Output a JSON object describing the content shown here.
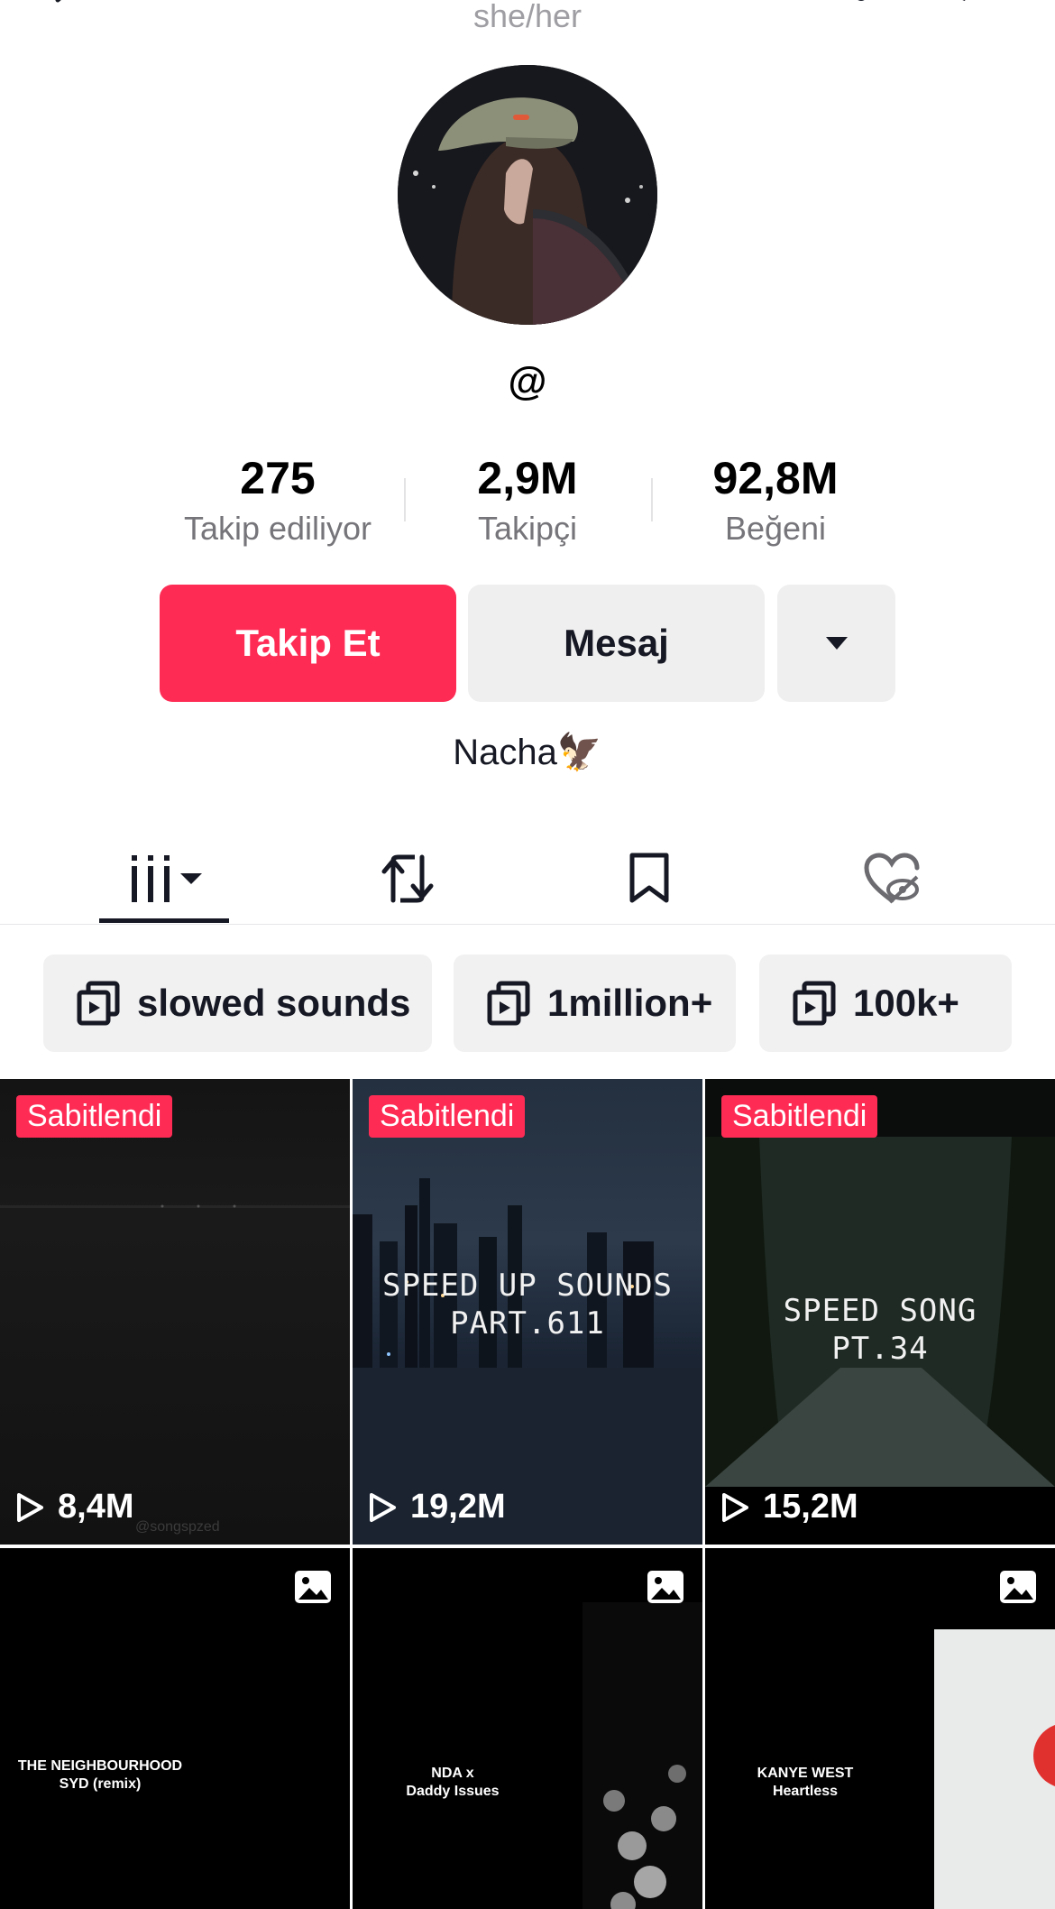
{
  "profile": {
    "pronouns": "she/her",
    "handle": "@",
    "bio": "Nacha🦅"
  },
  "stats": [
    {
      "value": "275",
      "label": "Takip ediliyor"
    },
    {
      "value": "2,9M",
      "label": "Takipçi"
    },
    {
      "value": "92,8M",
      "label": "Beğeni"
    }
  ],
  "buttons": {
    "follow": "Takip Et",
    "message": "Mesaj"
  },
  "playlists": [
    {
      "label": "slowed sounds"
    },
    {
      "label": "1million+"
    },
    {
      "label": "100k+"
    }
  ],
  "grid": {
    "pinned_label": "Sabitlendi",
    "items": [
      {
        "views": "8,4M",
        "watermark": "@songspzed"
      },
      {
        "views": "19,2M",
        "overlay_line1": "SPEED UP SOUNDS",
        "overlay_line2": "PART.611"
      },
      {
        "views": "15,2M",
        "overlay_line1": "SPEED SONG",
        "overlay_line2": "PT.34"
      },
      {
        "line1": "THE NEIGHBOURHOOD",
        "line2": "SYD (remix)"
      },
      {
        "line1": "NDA x",
        "line2": "Daddy Issues"
      },
      {
        "line1": "KANYE WEST",
        "line2": "Heartless"
      }
    ]
  },
  "colors": {
    "accent": "#fe2c55",
    "button_gray": "#efeff0",
    "secondary_text": "#75757a"
  }
}
